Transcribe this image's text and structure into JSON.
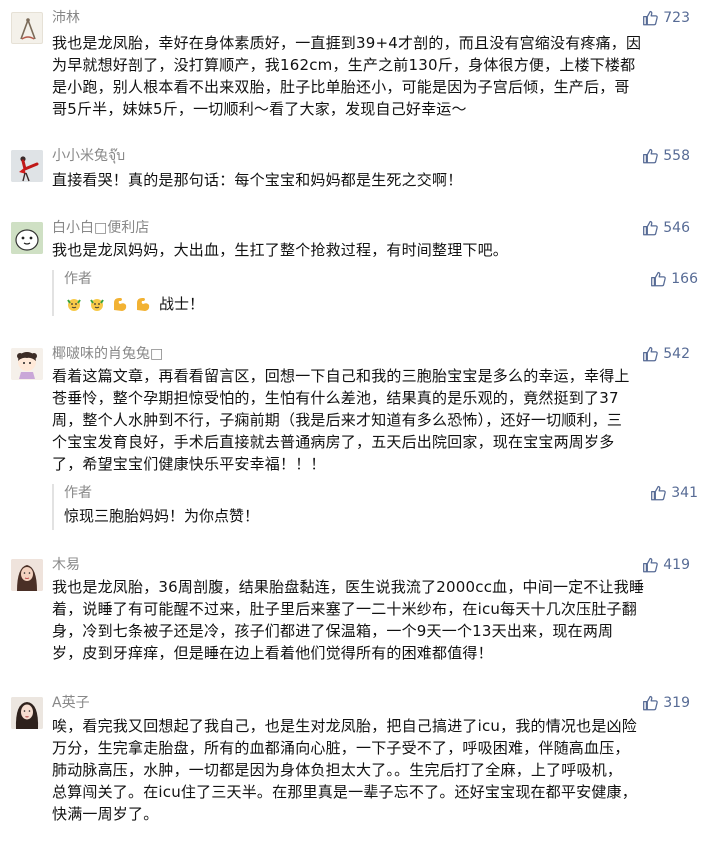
{
  "comments": [
    {
      "user": "沛林",
      "likes": "723",
      "lines": [
        "我也是龙凤胎，幸好在身体素质好，一直捱到39+4才剖的，而且没有宫缩没有疼痛，因",
        "为早就想好剖了，没打算顺产，我162cm，生产之前130斤，身体很方便，上楼下楼都",
        "是小跑，别人根本看不出来双胎，肚子比单胎还小，可能是因为子宫后倾，生产后，哥",
        "哥5斤半，妹妹5斤，一切顺利～看了大家，发现自己好幸运～"
      ]
    },
    {
      "user": "小小米兔จุ๊บ",
      "likes": "558",
      "lines": [
        "直接看哭！真的是那句话：每个宝宝和妈妈都是生死之交啊！"
      ]
    },
    {
      "user": "白小白□便利店",
      "likes": "546",
      "lines": [
        "我也是龙凤妈妈，大出血，生扛了整个抢救过程，有时间整理下吧。"
      ],
      "reply": {
        "author": "作者",
        "likes": "166",
        "text": "战士！"
      }
    },
    {
      "user": "椰啵味的肖兔兔□",
      "likes": "542",
      "lines": [
        "看着这篇文章，再看看留言区，回想一下自己和我的三胞胎宝宝是多么的幸运，幸得上",
        "苍垂怜，整个孕期担惊受怕的，生怕有什么差池，结果真的是乐观的，竟然挺到了37",
        "周，整个人水肿到不行，子痫前期（我是后来才知道有多么恐怖），还好一切顺利，三",
        "个宝宝发育良好，手术后直接就去普通病房了，五天后出院回家，现在宝宝两周岁多",
        "了，希望宝宝们健康快乐平安幸福！！！"
      ],
      "reply": {
        "author": "作者",
        "likes": "341",
        "text": "惊现三胞胎妈妈！为你点赞！"
      }
    },
    {
      "user": "木易",
      "likes": "419",
      "lines": [
        "我也是龙凤胎，36周剖腹，结果胎盘黏连，医生说我流了2000cc血，中间一定不让我睡",
        "着，说睡了有可能醒不过来，肚子里后来塞了一二十米纱布，在icu每天十几次压肚子翻",
        "身，冷到七条被子还是冷，孩子们都进了保温箱，一个9天一个13天出来，现在两周",
        "岁，皮到牙痒痒，但是睡在边上看着他们觉得所有的困难都值得！"
      ]
    },
    {
      "user": "A英子",
      "likes": "319",
      "lines": [
        "唉，看完我又回想起了我自己，也是生对龙凤胎，把自己搞进了icu，我的情况也是凶险",
        "万分，生完拿走胎盘，所有的血都涌向心脏，一下子受不了，呼吸困难，伴随高血压，",
        "肺动脉高压，水肿，一切都是因为身体负担太大了。。生完后打了全麻，上了呼吸机，",
        "总算闯关了。在icu住了三天半。在那里真是一辈子忘不了。还好宝宝现在都平安健康，",
        "快满一周岁了。"
      ]
    }
  ]
}
